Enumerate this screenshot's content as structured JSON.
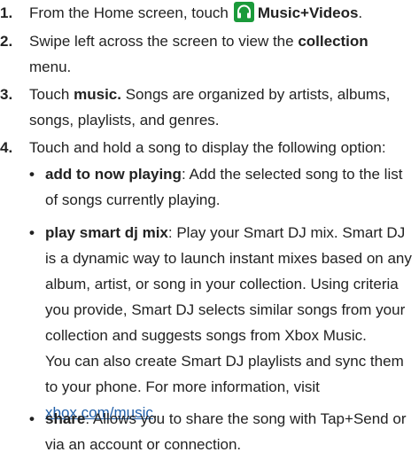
{
  "steps": [
    {
      "number": "1.",
      "text_before": "From the Home screen, touch",
      "app_icon": "headphones-icon",
      "app_name": "Music+Videos",
      "text_after": "."
    },
    {
      "number": "2.",
      "text_before": "Swipe left across the screen to view the",
      "bold": "collection",
      "text_after": "menu."
    },
    {
      "number": "3.",
      "text_before": "Touch",
      "bold": "music.",
      "text_after": "Songs are organized by artists, albums, songs, playlists, and genres."
    },
    {
      "number": "4.",
      "text": "Touch and hold a song to display the following option:"
    }
  ],
  "options": [
    {
      "term": "add to now playing",
      "desc": ": Add the selected song to the list of songs currently playing."
    },
    {
      "term": "play smart dj mix",
      "desc": ": Play your Smart DJ mix. Smart DJ is a dynamic way to launch instant mixes based on any album, artist, or song in your collection. Using criteria you provide, Smart DJ selects similar songs from your collection and suggests songs from Xbox Music.",
      "extra": "You can also create Smart DJ playlists and sync them to your phone. For more information, visit",
      "link": "xbox.com/music",
      "extra_end": "."
    },
    {
      "term": "share",
      "desc": ": Allows you to share the song with Tap+Send or via an account or connection."
    }
  ],
  "bullet_char": "•",
  "colors": {
    "icon_green": "#1a9a3a",
    "link": "#1f5ea8"
  }
}
